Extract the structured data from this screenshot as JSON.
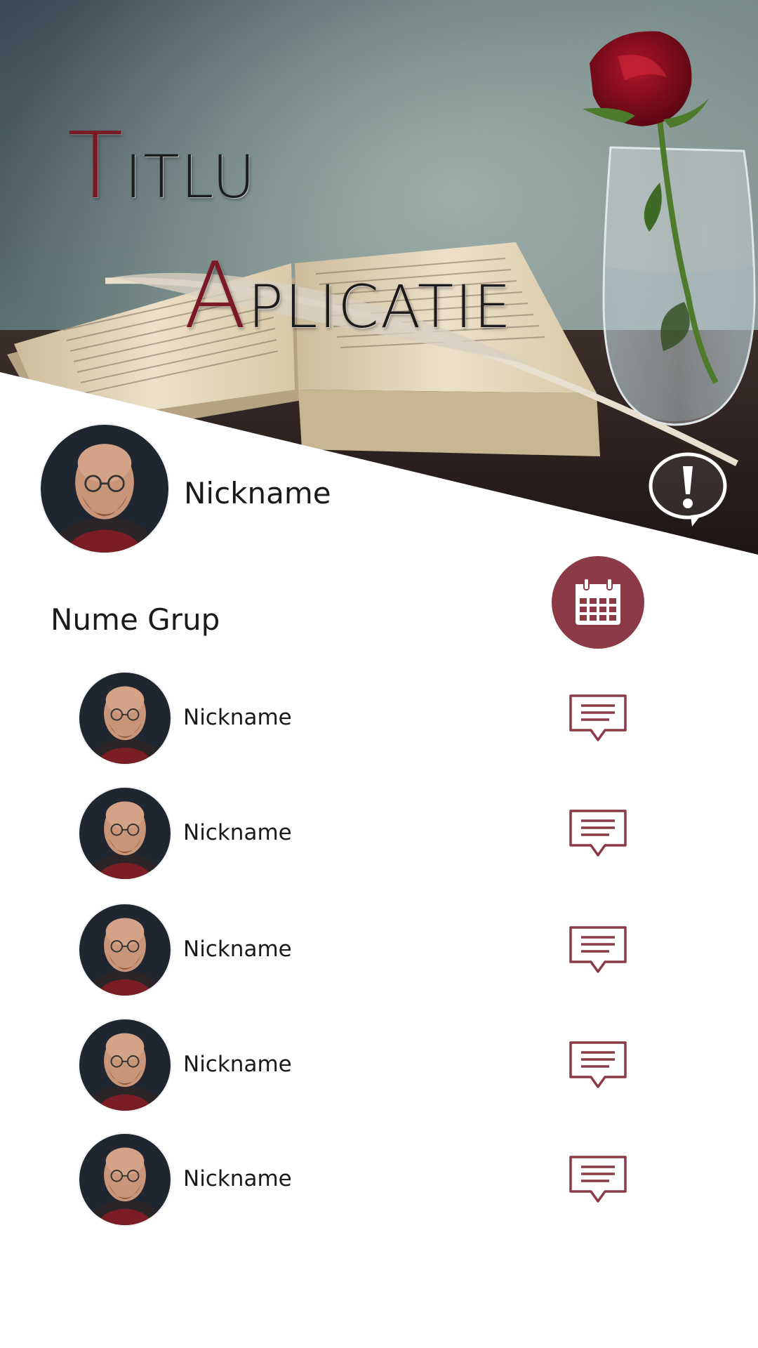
{
  "header": {
    "title_line1_initial": "T",
    "title_line1_rest": "ITLU",
    "title_line2_initial": "A",
    "title_line2_rest": "PLICATIE"
  },
  "profile": {
    "nickname": "Nickname",
    "avatar_icon": "user-portrait-avatar"
  },
  "alert": {
    "icon": "exclamation-speech-bubble-icon"
  },
  "group": {
    "name": "Nume Grup",
    "calendar_icon": "calendar-icon",
    "members": [
      {
        "nickname": "Nickname",
        "action_icon": "chat-bubble-icon"
      },
      {
        "nickname": "Nickname",
        "action_icon": "chat-bubble-icon"
      },
      {
        "nickname": "Nickname",
        "action_icon": "chat-bubble-icon"
      },
      {
        "nickname": "Nickname",
        "action_icon": "chat-bubble-icon"
      },
      {
        "nickname": "Nickname",
        "action_icon": "chat-bubble-icon"
      }
    ]
  },
  "colors": {
    "accent": "#8c3b46",
    "title_initial": "#7a1a26",
    "text": "#1a1a1a",
    "background": "#ffffff"
  }
}
